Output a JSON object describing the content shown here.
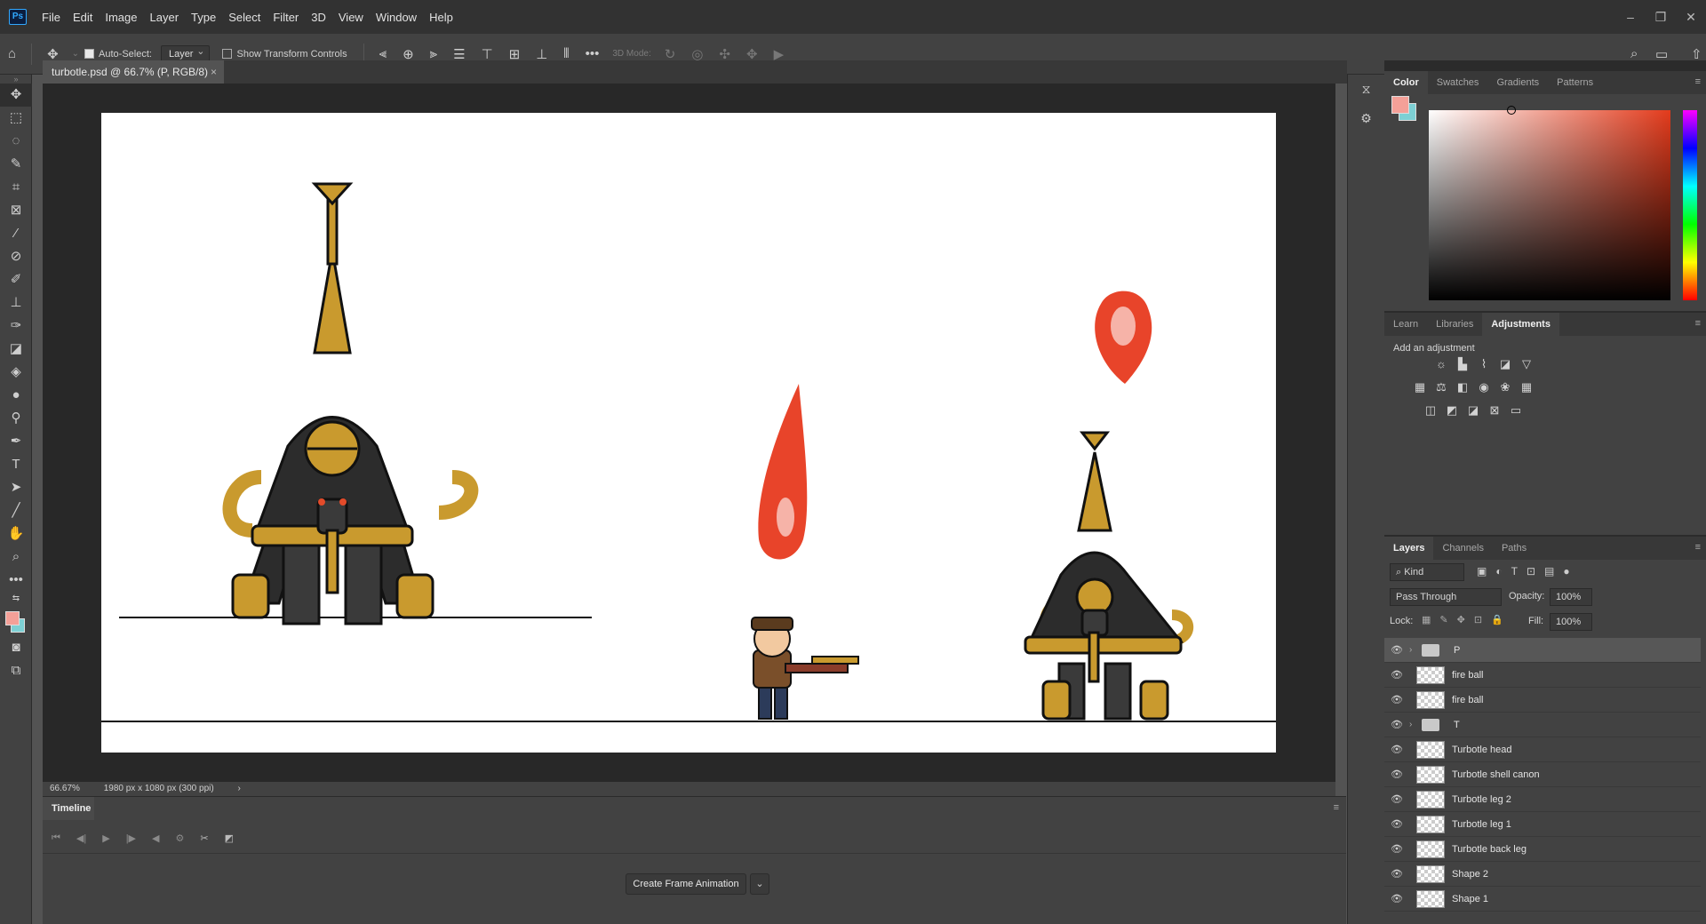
{
  "app": {
    "logo": "Ps"
  },
  "menu": [
    "File",
    "Edit",
    "Image",
    "Layer",
    "Type",
    "Select",
    "Filter",
    "3D",
    "View",
    "Window",
    "Help"
  ],
  "options": {
    "auto_select_label": "Auto-Select:",
    "auto_select_checked": true,
    "layer_select": "Layer",
    "show_transform_label": "Show Transform Controls",
    "show_transform_checked": false,
    "mode_3d_label": "3D Mode:"
  },
  "document": {
    "tab_title": "turbotle.psd @ 66.7% (P, RGB/8)",
    "zoom": "66.67%",
    "info": "1980 px x 1080 px (300 ppi)"
  },
  "timeline": {
    "tab": "Timeline",
    "create_button": "Create Frame Animation"
  },
  "color_panel": {
    "tabs": [
      "Color",
      "Swatches",
      "Gradients",
      "Patterns"
    ],
    "fg_color": "#f4a098",
    "bg_color": "#7dd0d4"
  },
  "adjust_panel": {
    "tabs": [
      "Learn",
      "Libraries",
      "Adjustments"
    ],
    "add_label": "Add an adjustment"
  },
  "layers_panel": {
    "tabs": [
      "Layers",
      "Channels",
      "Paths"
    ],
    "filter": "Kind",
    "blend_mode": "Pass Through",
    "opacity_label": "Opacity:",
    "opacity": "100%",
    "lock_label": "Lock:",
    "fill_label": "Fill:",
    "fill": "100%",
    "layers": [
      {
        "name": "P",
        "type": "group"
      },
      {
        "name": "fire ball",
        "type": "layer"
      },
      {
        "name": "fire ball",
        "type": "layer"
      },
      {
        "name": "T",
        "type": "group"
      },
      {
        "name": "Turbotle head",
        "type": "layer"
      },
      {
        "name": "Turbotle shell canon",
        "type": "layer"
      },
      {
        "name": "Turbotle leg 2",
        "type": "layer"
      },
      {
        "name": "Turbotle leg 1",
        "type": "layer"
      },
      {
        "name": "Turbotle back leg",
        "type": "layer"
      },
      {
        "name": "Shape 2",
        "type": "layer"
      },
      {
        "name": "Shape 1",
        "type": "layer"
      }
    ]
  }
}
